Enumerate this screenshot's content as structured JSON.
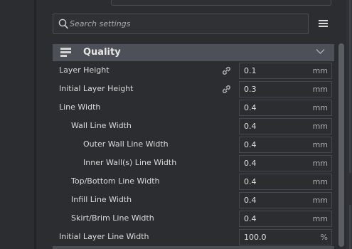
{
  "search": {
    "placeholder": "Search settings",
    "icon": "search-icon"
  },
  "settings_menu": {
    "icon": "hamburger-menu-icon"
  },
  "category": {
    "title": "Quality",
    "icon": "quality-layers-icon",
    "chevron": "chevron-down-icon"
  },
  "settings": [
    {
      "label": "Layer Height",
      "value": "0.1",
      "unit": "mm",
      "linked": true
    },
    {
      "label": "Initial Layer Height",
      "value": "0.3",
      "unit": "mm",
      "linked": true
    },
    {
      "label": "Line Width",
      "value": "0.4",
      "unit": "mm",
      "linked": false
    },
    {
      "label": "Wall Line Width",
      "value": "0.4",
      "unit": "mm",
      "linked": false
    },
    {
      "label": "Outer Wall Line Width",
      "value": "0.4",
      "unit": "mm",
      "linked": false
    },
    {
      "label": "Inner Wall(s) Line Width",
      "value": "0.4",
      "unit": "mm",
      "linked": false
    },
    {
      "label": "Top/Bottom Line Width",
      "value": "0.4",
      "unit": "mm",
      "linked": false
    },
    {
      "label": "Infill Line Width",
      "value": "0.4",
      "unit": "mm",
      "linked": false
    },
    {
      "label": "Skirt/Brim Line Width",
      "value": "0.4",
      "unit": "mm",
      "linked": false
    },
    {
      "label": "Initial Layer Line Width",
      "value": "100.0",
      "unit": "%",
      "linked": false
    }
  ],
  "colors": {
    "background": "#2b2d30",
    "category_header": "#4d5057",
    "field_border": "#45484d",
    "text": "#dcdcdc",
    "unit_text": "#a9acb0"
  }
}
